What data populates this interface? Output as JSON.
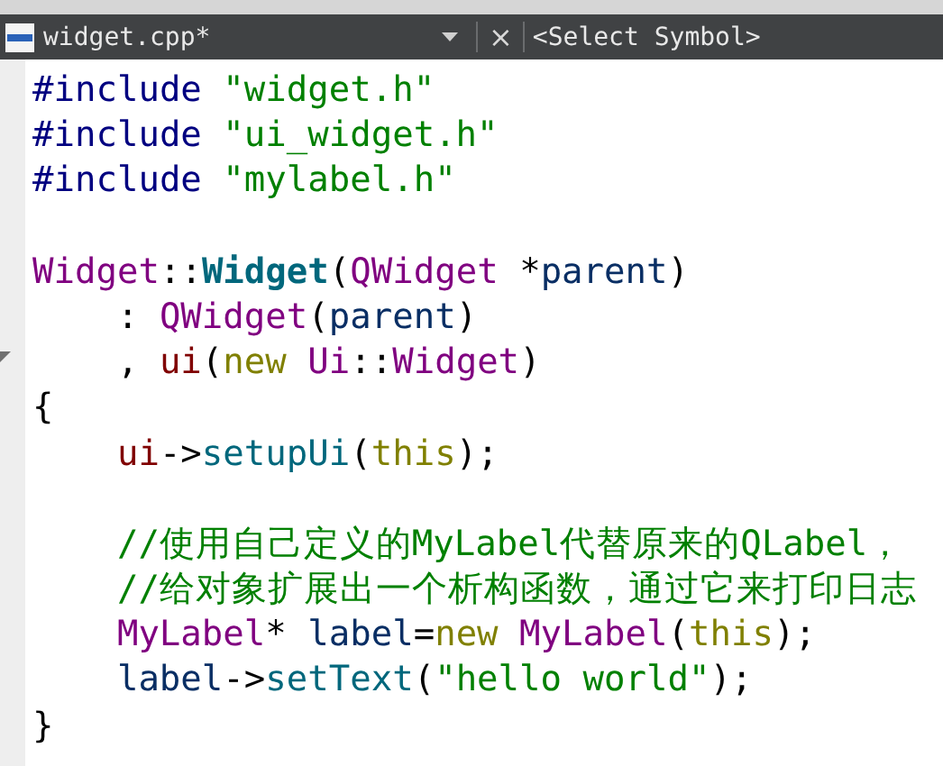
{
  "tab": {
    "file": "widget.cpp*",
    "close": "×",
    "symbol": "<Select Symbol>"
  },
  "lines": [
    {
      "kind": "code",
      "tokens": [
        {
          "kind": "preproc",
          "text": "#include "
        },
        {
          "kind": "string",
          "text": "\"widget.h\""
        }
      ]
    },
    {
      "kind": "code",
      "tokens": [
        {
          "kind": "preproc",
          "text": "#include "
        },
        {
          "kind": "string",
          "text": "\"ui_widget.h\""
        }
      ]
    },
    {
      "kind": "code",
      "tokens": [
        {
          "kind": "preproc",
          "text": "#include "
        },
        {
          "kind": "string",
          "text": "\"mylabel.h\""
        }
      ]
    },
    {
      "kind": "blank"
    },
    {
      "kind": "code",
      "tokens": [
        {
          "kind": "type",
          "text": "Widget"
        },
        {
          "kind": "plain",
          "text": "::"
        },
        {
          "kind": "decl",
          "text": "Widget"
        },
        {
          "kind": "plain",
          "text": "("
        },
        {
          "kind": "type",
          "text": "QWidget"
        },
        {
          "kind": "plain",
          "text": " *"
        },
        {
          "kind": "param",
          "text": "parent"
        },
        {
          "kind": "plain",
          "text": ")"
        }
      ]
    },
    {
      "kind": "code",
      "indent": true,
      "tokens": [
        {
          "kind": "plain",
          "text": ": "
        },
        {
          "kind": "type",
          "text": "QWidget"
        },
        {
          "kind": "plain",
          "text": "("
        },
        {
          "kind": "param",
          "text": "parent"
        },
        {
          "kind": "plain",
          "text": ")"
        }
      ]
    },
    {
      "kind": "code",
      "indent": true,
      "tokens": [
        {
          "kind": "plain",
          "text": ", "
        },
        {
          "kind": "field",
          "text": "ui"
        },
        {
          "kind": "plain",
          "text": "("
        },
        {
          "kind": "keyword",
          "text": "new "
        },
        {
          "kind": "type",
          "text": "Ui"
        },
        {
          "kind": "plain",
          "text": "::"
        },
        {
          "kind": "type",
          "text": "Widget"
        },
        {
          "kind": "plain",
          "text": ")"
        }
      ]
    },
    {
      "kind": "code",
      "tokens": [
        {
          "kind": "plain",
          "text": "{"
        }
      ]
    },
    {
      "kind": "code",
      "indent": true,
      "tokens": [
        {
          "kind": "field",
          "text": "ui"
        },
        {
          "kind": "plain",
          "text": "->"
        },
        {
          "kind": "func",
          "text": "setupUi"
        },
        {
          "kind": "plain",
          "text": "("
        },
        {
          "kind": "keyword",
          "text": "this"
        },
        {
          "kind": "plain",
          "text": ");"
        }
      ]
    },
    {
      "kind": "blank"
    },
    {
      "kind": "code",
      "indent": true,
      "tokens": [
        {
          "kind": "comment",
          "text": "//使用自己定义的MyLabel代替原来的QLabel，"
        }
      ]
    },
    {
      "kind": "code",
      "indent": true,
      "tokens": [
        {
          "kind": "comment",
          "text": "//给对象扩展出一个析构函数，通过它来打印日志"
        }
      ]
    },
    {
      "kind": "code",
      "indent": true,
      "tokens": [
        {
          "kind": "type",
          "text": "MyLabel"
        },
        {
          "kind": "plain",
          "text": "* "
        },
        {
          "kind": "param",
          "text": "label"
        },
        {
          "kind": "plain",
          "text": "="
        },
        {
          "kind": "keyword",
          "text": "new "
        },
        {
          "kind": "type",
          "text": "MyLabel"
        },
        {
          "kind": "plain",
          "text": "("
        },
        {
          "kind": "keyword",
          "text": "this"
        },
        {
          "kind": "plain",
          "text": ");"
        }
      ]
    },
    {
      "kind": "code",
      "indent": true,
      "tokens": [
        {
          "kind": "param",
          "text": "label"
        },
        {
          "kind": "plain",
          "text": "->"
        },
        {
          "kind": "func",
          "text": "setText"
        },
        {
          "kind": "plain",
          "text": "("
        },
        {
          "kind": "string",
          "text": "\"hello world\""
        },
        {
          "kind": "plain",
          "text": ");"
        }
      ]
    },
    {
      "kind": "code",
      "tokens": [
        {
          "kind": "plain",
          "text": "}"
        }
      ]
    }
  ]
}
